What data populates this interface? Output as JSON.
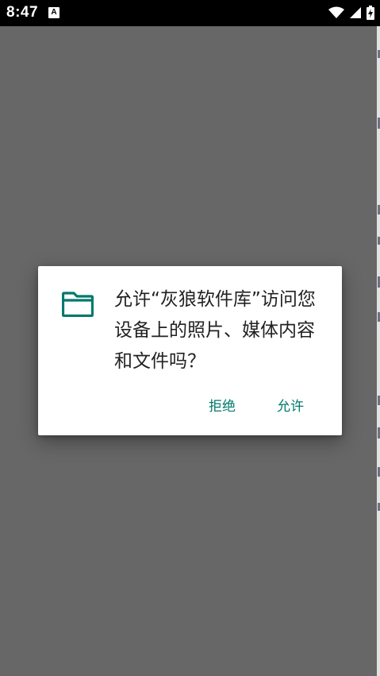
{
  "status_bar": {
    "time": "8:47",
    "notification_icon": "A",
    "icons": [
      "wifi-icon",
      "cellular-icon",
      "battery-charging-icon"
    ]
  },
  "dialog": {
    "icon": "folder-icon",
    "message": "允许“灰狼软件库”访问您设备上的照片、媒体内容和文件吗？",
    "buttons": {
      "deny": "拒绝",
      "allow": "允许"
    }
  },
  "colors": {
    "accent": "#00796b",
    "scrim": "#676767",
    "dialog_bg": "#ffffff",
    "text": "#222222"
  }
}
